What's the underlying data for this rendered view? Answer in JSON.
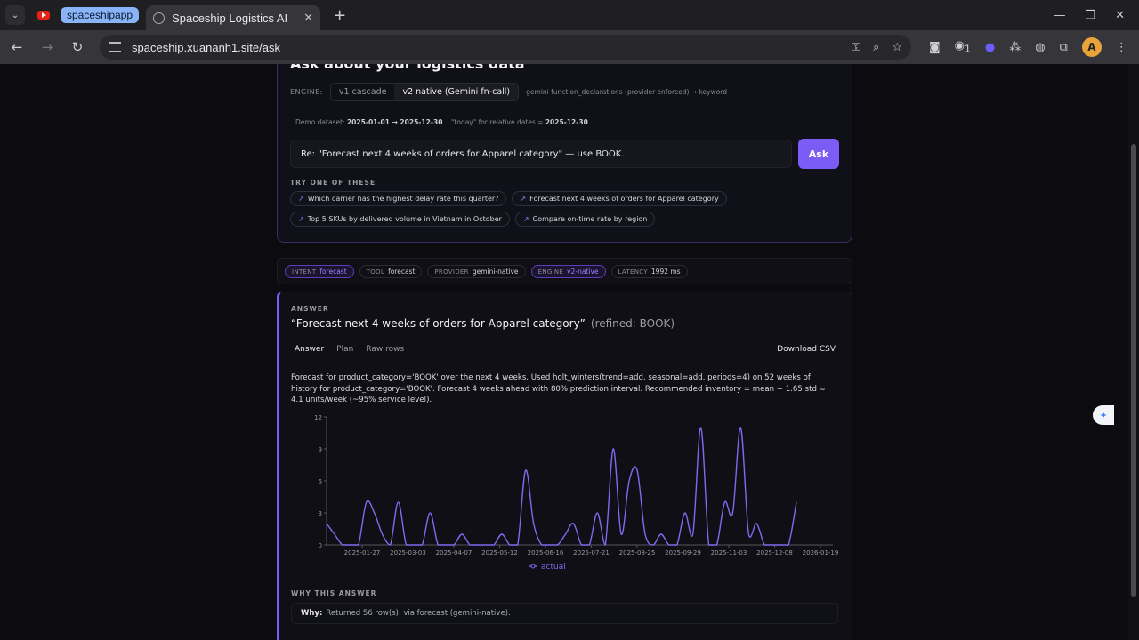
{
  "browser": {
    "tab_group_label": "spaceshipapp",
    "active_tab_title": "Spaceship Logistics AI",
    "url": "spaceship.xuananh1.site/ask",
    "extension_badge": "1",
    "profile_initial": "A"
  },
  "ask_card": {
    "title": "Ask about your logistics data",
    "engine_label": "ENGINE:",
    "engine_options": [
      "v1 cascade",
      "v2 native (Gemini fn-call)"
    ],
    "engine_selected": "v2 native (Gemini fn-call)",
    "engine_note": "gemini function_declarations (provider-enforced) → keyword",
    "dataset_prefix": "Demo dataset:",
    "dataset_range": "2025-01-01 → 2025-12-30",
    "today_prefix": "\"today\" for relative dates =",
    "today_value": "2025-12-30",
    "input_value": "Re: \"Forecast next 4 weeks of orders for Apparel category\" — use BOOK.",
    "ask_button": "Ask",
    "try_label": "TRY ONE OF THESE",
    "suggestions": [
      "Which carrier has the highest delay rate this quarter?",
      "Forecast next 4 weeks of orders for Apparel category",
      "Top 5 SKUs by delivered volume in Vietnam in October",
      "Compare on-time rate by region"
    ]
  },
  "meta": {
    "intent_label": "INTENT",
    "intent_value": "forecast",
    "tool_label": "TOOL",
    "tool_value": "forecast",
    "provider_label": "PROVIDER",
    "provider_value": "gemini-native",
    "engine_label": "ENGINE",
    "engine_value": "v2-native",
    "latency_label": "LATENCY",
    "latency_value": "1992 ms"
  },
  "answer": {
    "label": "ANSWER",
    "question": "“Forecast next 4 weeks of orders for Apparel category”",
    "refined": "(refined: BOOK)",
    "tabs": [
      "Answer",
      "Plan",
      "Raw rows"
    ],
    "download": "Download CSV",
    "text": "Forecast for product_category='BOOK' over the next 4 weeks. Used holt_winters(trend=add, seasonal=add, periods=4) on 52 weeks of history for product_category='BOOK'. Forecast 4 weeks ahead with 80% prediction interval. Recommended inventory = mean + 1.65·std ≈ 4.1 units/week (~95% service level).",
    "why_label": "WHY THIS ANSWER",
    "why_prefix": "Why:",
    "why_text": "Returned 56 row(s). via forecast (gemini-native)."
  },
  "chart_data": {
    "type": "line",
    "series": [
      {
        "name": "actual",
        "color": "#7c6cf0",
        "values": [
          2,
          1,
          0,
          0,
          0,
          4,
          3,
          1,
          0,
          4,
          0,
          0,
          0,
          3,
          0,
          0,
          0,
          1,
          0,
          0,
          0,
          0,
          1,
          0,
          0,
          7,
          2,
          0,
          0,
          0,
          1,
          2,
          0,
          0,
          3,
          0,
          9,
          1,
          6,
          7,
          1,
          0,
          1,
          0,
          0,
          3,
          1,
          11,
          0,
          0,
          4,
          3,
          11,
          1,
          2,
          0,
          0,
          0,
          0,
          4
        ]
      }
    ],
    "x_tick_labels": [
      "2025-01-27",
      "2025-03-03",
      "2025-04-07",
      "2025-05-12",
      "2025-06-16",
      "2025-07-21",
      "2025-08-25",
      "2025-09-29",
      "2025-11-03",
      "2025-12-08",
      "2026-01-19"
    ],
    "y_ticks": [
      0,
      3,
      6,
      9,
      12
    ],
    "ylim": [
      0,
      12
    ],
    "legend_position": "bottom"
  }
}
